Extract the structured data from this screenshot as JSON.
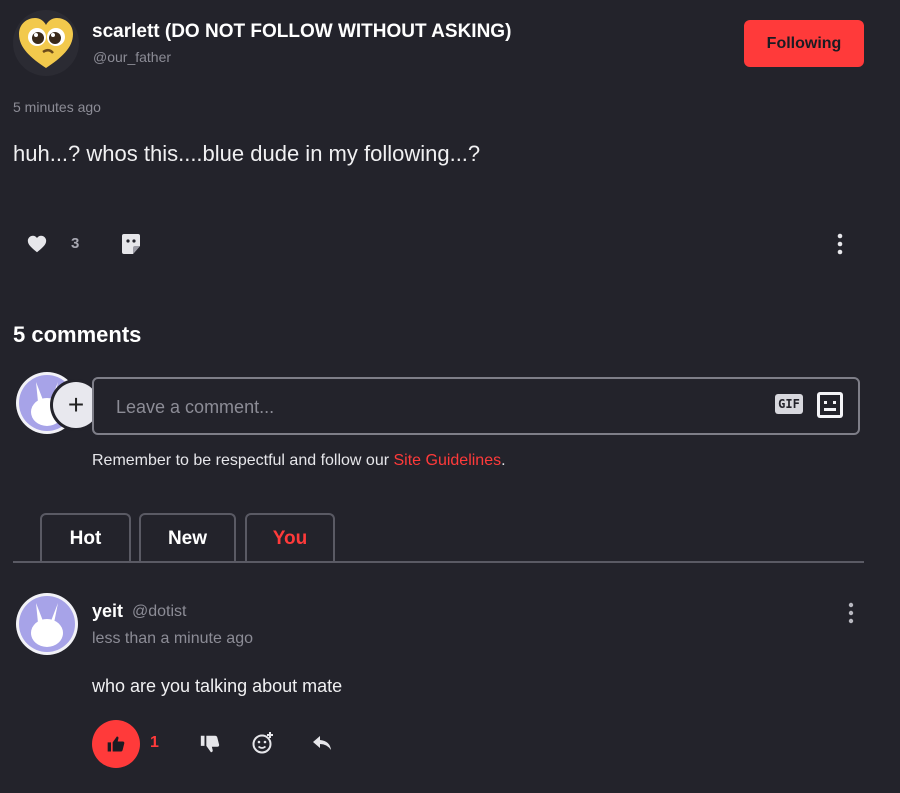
{
  "post": {
    "author_name": "scarlett (DO NOT FOLLOW WITHOUT ASKING)",
    "author_handle": "@our_father",
    "follow_label": "Following",
    "timestamp": "5 minutes ago",
    "text": "huh...? whos this....blue dude in my following...?",
    "like_count": "3"
  },
  "comments_section": {
    "heading": "5 comments",
    "input_placeholder": "Leave a comment...",
    "gif_label": "GIF",
    "guideline_prefix": "Remember to be respectful and follow our ",
    "guideline_link": "Site Guidelines",
    "guideline_suffix": "."
  },
  "tabs": [
    {
      "label": "Hot"
    },
    {
      "label": "New"
    },
    {
      "label": "You",
      "active": true
    }
  ],
  "comments": [
    {
      "name": "yeit",
      "handle": "@dotist",
      "time": "less than a minute ago",
      "body": "who are you talking about mate",
      "like_count": "1"
    }
  ],
  "colors": {
    "background": "#23232b",
    "accent": "#ff3a3a",
    "muted_text": "#8c8c96",
    "border": "#5a5a64"
  },
  "icons": [
    "heart-icon",
    "sticker-icon",
    "more-vertical-icon",
    "plus-icon",
    "gif-icon",
    "emoji-picker-icon",
    "thumbs-up-icon",
    "thumbs-down-icon",
    "add-reaction-icon",
    "reply-icon"
  ]
}
